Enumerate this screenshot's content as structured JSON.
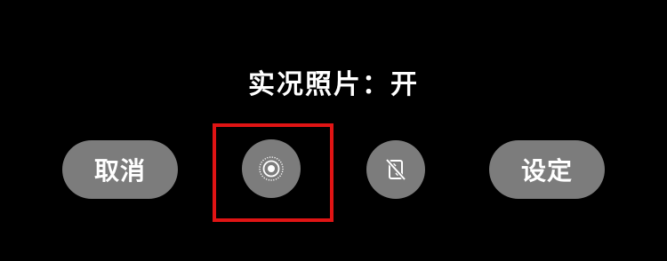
{
  "status": {
    "live_photo_text": "实况照片：开"
  },
  "buttons": {
    "cancel_label": "取消",
    "settings_label": "设定",
    "live_photo_icon": "live-photo-icon",
    "flip_camera_icon": "camera-flip-off-icon"
  },
  "colors": {
    "background": "#000000",
    "button_fill": "#7c7c7c",
    "text": "#ffffff",
    "highlight": "#e01414"
  }
}
